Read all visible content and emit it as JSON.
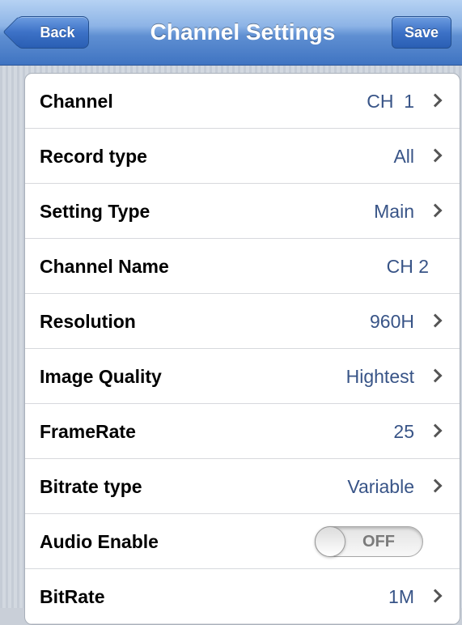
{
  "navbar": {
    "title": "Channel Settings",
    "back_label": "Back",
    "save_label": "Save"
  },
  "rows": [
    {
      "label": "Channel",
      "value": "CH  1",
      "has_arrow": true
    },
    {
      "label": "Record type",
      "value": "All",
      "has_arrow": true
    },
    {
      "label": "Setting Type",
      "value": "Main",
      "has_arrow": true
    },
    {
      "label": "Channel Name",
      "value": "CH 2",
      "has_arrow": false
    },
    {
      "label": "Resolution",
      "value": "960H",
      "has_arrow": true
    },
    {
      "label": "Image Quality",
      "value": "Hightest",
      "has_arrow": true
    },
    {
      "label": "FrameRate",
      "value": "25",
      "has_arrow": true
    },
    {
      "label": "Bitrate type",
      "value": "Variable",
      "has_arrow": true
    },
    {
      "label": "Audio Enable",
      "toggle": "OFF"
    },
    {
      "label": "BitRate",
      "value": "1M",
      "has_arrow": true
    }
  ],
  "colors": {
    "navbar_blue": "#3f74c2",
    "value_text": "#385487"
  }
}
